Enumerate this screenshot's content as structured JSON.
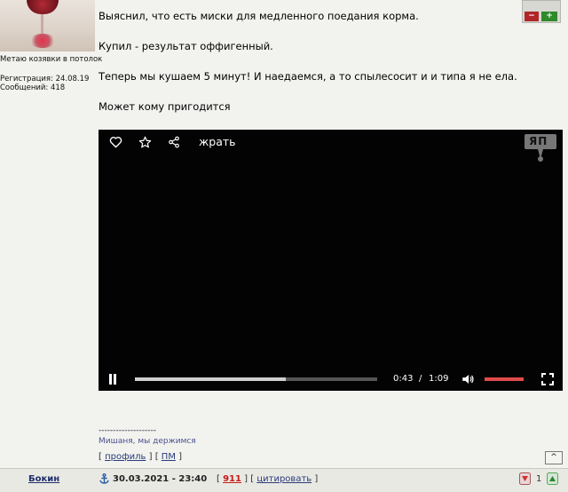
{
  "user": {
    "status": "Метаю козявки в потолок",
    "registration": "Регистрация: 24.08.19",
    "posts": "Сообщений: 418"
  },
  "post": {
    "line1": "Выяснил, что есть миски для медленного поедания корма.",
    "line2": "Купил - результат оффигенный.",
    "line3": "Теперь мы кушаем 5 минут! И наедаемся, а то спылесосит и и типа я не ела.",
    "line4": "Может кому пригодится"
  },
  "video": {
    "title": "жрать",
    "logo": "ЯП",
    "current_time": "0:43",
    "separator": "/",
    "duration": "1:09",
    "progress_fraction": 0.623,
    "volume_fraction": 1.0,
    "icons": [
      "heart-icon",
      "star-icon",
      "share-icon",
      "pause-icon",
      "volume-icon",
      "fullscreen-icon"
    ]
  },
  "signature": {
    "divider": "--------------------",
    "text": "Мишаня, мы держимся"
  },
  "post_links": {
    "open": "[",
    "profile": "профиль",
    "sep": "] [",
    "pm": "ПМ",
    "close": "]"
  },
  "up_button": "^",
  "next_post": {
    "author": "Бокин",
    "date": "30.03.2021 - 23:40",
    "open": "[",
    "number": "911",
    "sep": "] [",
    "quote": "цитировать",
    "close": "]",
    "rating": "1"
  },
  "vote": {
    "minus": "−",
    "plus": "+"
  },
  "colors": {
    "background": "#f2f3ef",
    "link": "#2a3b7a",
    "number_red": "#c41b1b",
    "volume_red": "#e04c4c"
  }
}
